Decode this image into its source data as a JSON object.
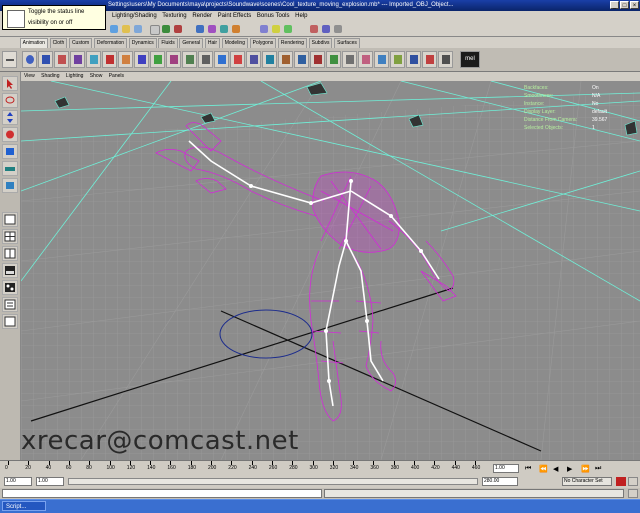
{
  "window": {
    "title": "Settings\\users\\My Documents\\maya\\projects\\Soundwave\\scenes\\Cool_texture_moving_explosion.mb*  ---  Imported_OBJ_Object...",
    "controls": [
      "_",
      "□",
      "×"
    ]
  },
  "tooltip": {
    "line1": "Toggle the status line",
    "line2": "visibility on or off"
  },
  "menubar": {
    "items": [
      "Lighting/Shading",
      "Texturing",
      "Render",
      "Paint Effects",
      "Bonus Tools",
      "Help"
    ]
  },
  "shelf": {
    "tabs": [
      "Animation",
      "Cloth",
      "Custom",
      "Deformation",
      "Dynamics",
      "Fluids",
      "General",
      "Hair",
      "Modeling",
      "Polygons",
      "Rendering",
      "Subdivs",
      "Surfaces"
    ],
    "active_tab": "Animation",
    "mel_label": "mel"
  },
  "panel": {
    "menu": [
      "View",
      "Shading",
      "Lighting",
      "Show",
      "Panels"
    ]
  },
  "hud": {
    "rows": [
      {
        "label": "Backfaces:",
        "value": "On"
      },
      {
        "label": "Smoothness:",
        "value": "N/A"
      },
      {
        "label": "Instance:",
        "value": "No"
      },
      {
        "label": "Display Layer:",
        "value": "default"
      },
      {
        "label": "Distance From Camera:",
        "value": "39.567"
      },
      {
        "label": "Selected Objects:",
        "value": "1"
      }
    ]
  },
  "watermark": "xrecar@comcast.net",
  "timeslider": {
    "ticks": [
      "0",
      "20",
      "40",
      "60",
      "80",
      "100",
      "120",
      "140",
      "160",
      "180",
      "200",
      "220",
      "240",
      "260",
      "280",
      "300",
      "320",
      "340",
      "360",
      "380",
      "400",
      "420",
      "440",
      "460"
    ],
    "current_frame": "1.00"
  },
  "range": {
    "start": "1.00",
    "end": "1.00",
    "playback_end": "280.00",
    "char_set": "No Character Set"
  },
  "taskbar": {
    "button": "Script..."
  },
  "colors": {
    "viewport_bg": "#8c8c8c",
    "wireframe": "#d22ad8",
    "skeleton": "#ffffff",
    "cyan_lines": "#6ff0d8"
  }
}
